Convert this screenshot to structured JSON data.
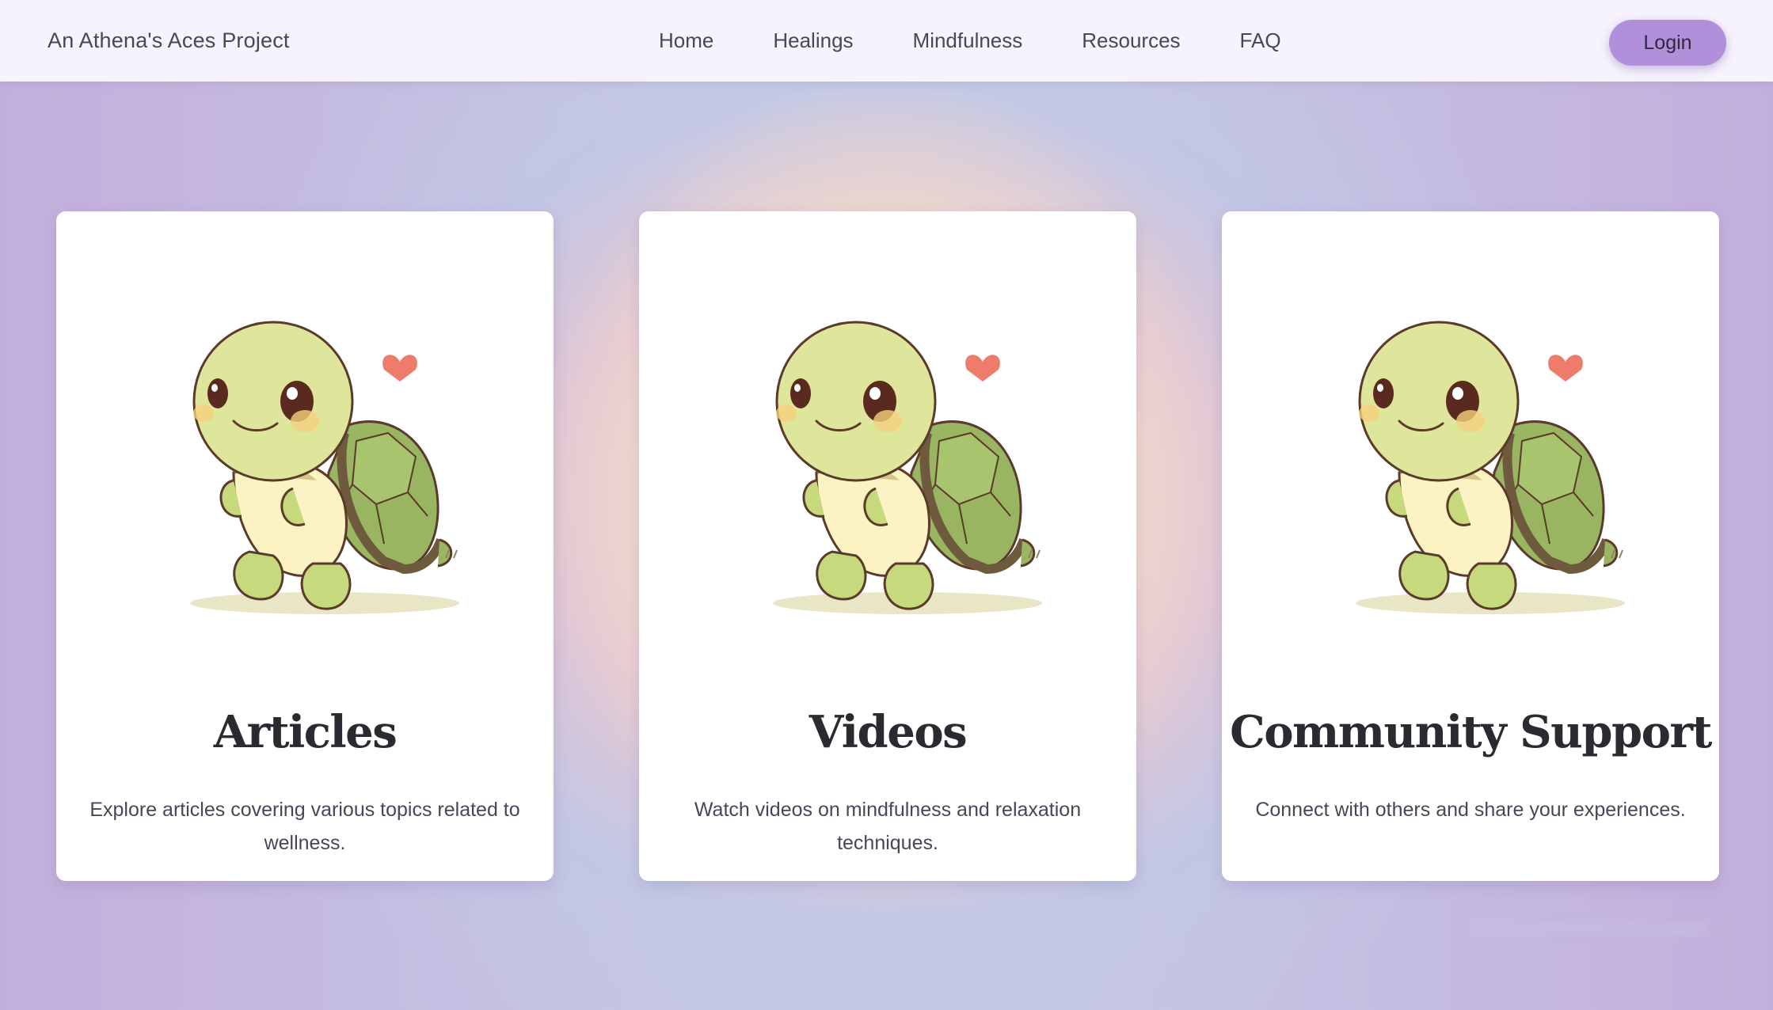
{
  "navbar": {
    "brand": "An Athena's Aces Project",
    "links": [
      {
        "label": "Home"
      },
      {
        "label": "Healings"
      },
      {
        "label": "Mindfulness"
      },
      {
        "label": "Resources"
      },
      {
        "label": "FAQ"
      }
    ],
    "login_label": "Login"
  },
  "cards": [
    {
      "title": "Articles",
      "description": "Explore articles covering various topics related to wellness.",
      "icon": "turtle-illustration"
    },
    {
      "title": "Videos",
      "description": "Watch videos on mindfulness and relaxation techniques.",
      "icon": "turtle-illustration"
    },
    {
      "title": "Community Support",
      "description": "Connect with others and share your experiences.",
      "icon": "turtle-illustration"
    }
  ],
  "colors": {
    "navbar_bg": "#f6f3fd",
    "login_button": "#b18fdb",
    "card_bg": "#ffffff",
    "title_text": "#2b2a30",
    "body_text": "#4a4658"
  }
}
